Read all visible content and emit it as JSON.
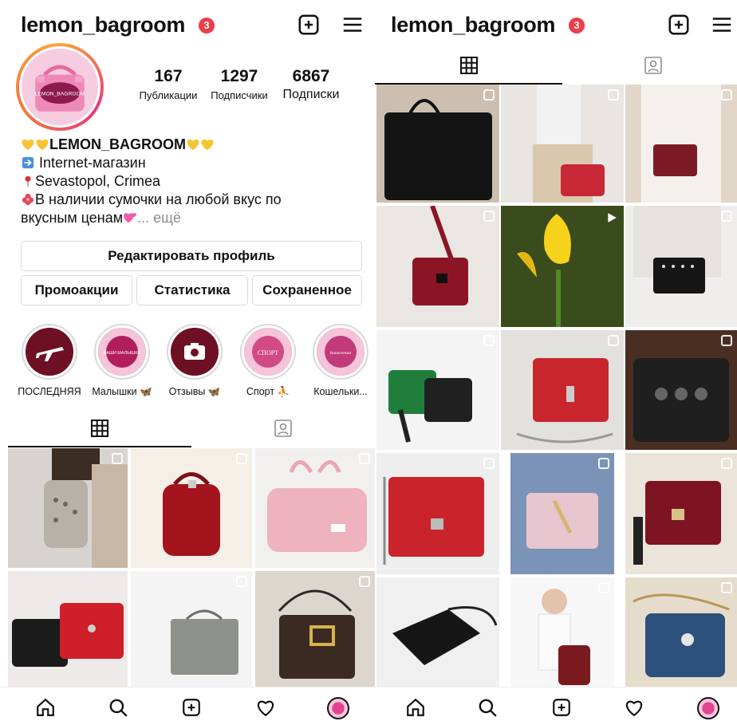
{
  "profile": {
    "username": "lemon_bagroom",
    "notification_count": "3",
    "avatar_text": "LEMON_BAGROOM",
    "stats": [
      {
        "value": "167",
        "label": "Публикации"
      },
      {
        "value": "1297",
        "label": "Подписчики"
      },
      {
        "value": "6867",
        "label": "Подписки"
      }
    ],
    "bio": {
      "name": "LEMON_BAGROOM",
      "line1": "Internet-магазин",
      "line2": "Sevastopol, Crimea",
      "line3": "В наличии сумочки на любой вкус по",
      "line4": "вкусным ценам",
      "more": "... ещё"
    },
    "buttons": {
      "edit_profile": "Редактировать профиль",
      "promotions": "Промоакции",
      "statistics": "Статистика",
      "saved": "Сохраненное"
    },
    "highlights": [
      {
        "label": "ПОСЛЕДНЯЯ",
        "icon": "airplane-icon"
      },
      {
        "label": "Малышки 🦋",
        "badge": "ВАШИ МАЛЫШКИ"
      },
      {
        "label": "Отзывы 🦋",
        "icon": "camera-icon"
      },
      {
        "label": "Спорт ⛹",
        "badge": "СПОРТ"
      },
      {
        "label": "Кошельки...",
        "badge": "Кошелечки"
      }
    ]
  },
  "tabs": [
    "grid-tab",
    "tagged-tab"
  ],
  "nav": [
    "home-icon",
    "search-icon",
    "add-post-icon",
    "activity-heart-icon",
    "profile-avatar"
  ],
  "colors": {
    "notification": "#ee3d4a",
    "story_ring": "#e63a7a",
    "highlight_bg": "#8b1a2e",
    "highlight_badge": "#d64d8b"
  }
}
